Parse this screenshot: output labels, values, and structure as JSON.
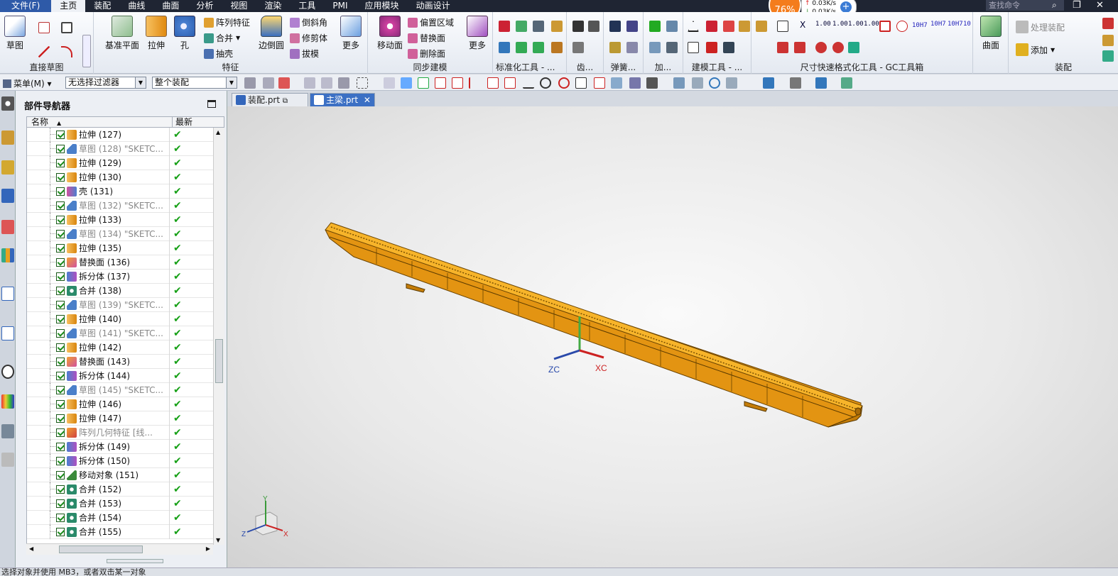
{
  "menubar": {
    "file": "文件(F)",
    "items": [
      "主页",
      "装配",
      "曲线",
      "曲面",
      "分析",
      "视图",
      "渲染",
      "工具",
      "PMI",
      "应用模块",
      "动画设计"
    ],
    "search_placeholder": "查找命令"
  },
  "perf": {
    "percent": "76%",
    "up": "0.03K/s",
    "down": "0.03K/s"
  },
  "ribbon": {
    "sketch_group": {
      "label": "直接草图",
      "sketch": "草图"
    },
    "feature_group": {
      "label": "特征",
      "datum_plane": "基准平面",
      "extrude": "拉伸",
      "hole": "孔",
      "pattern": "阵列特征",
      "unite": "合并",
      "shell": "抽壳",
      "edge_blend": "边倒圆",
      "chamfer": "倒斜角",
      "trim_body": "修剪体",
      "draft": "拔模",
      "more": "更多"
    },
    "sync_group": {
      "label": "同步建模",
      "move_face": "移动面",
      "offset_region": "偏置区域",
      "replace_face": "替换面",
      "delete_face": "删除面",
      "more": "更多"
    },
    "std_tools": {
      "label": "标准化工具 - ..."
    },
    "gear": {
      "label": "齿..."
    },
    "spring": {
      "label": "弹簧..."
    },
    "add": {
      "label": "加..."
    },
    "modeling_tools": {
      "label": "建模工具 - ..."
    },
    "dim_tools": {
      "label": "尺寸快速格式化工具 - GC工具箱",
      "t1": "1.00",
      "t2": "1.00",
      "t3": "1.00",
      "t4": "1.00",
      "x": "X",
      "h7a": "10H7",
      "h7b": "10H7",
      "h7c": "10H7",
      "h7d": "10"
    },
    "surface_group": {
      "surface": "曲面"
    },
    "assembly_group": {
      "label": "装配",
      "process": "处理装配",
      "add": "添加"
    }
  },
  "toolbar2": {
    "menu": "菜单(M)",
    "filter": "无选择过滤器",
    "scope": "整个装配"
  },
  "navigator": {
    "title": "部件导航器",
    "col_name": "名称",
    "col_latest": "最新",
    "rows": [
      {
        "label": "拉伸 (127)",
        "type": "extrude"
      },
      {
        "label": "草图 (128) \"SKETC...",
        "type": "sketch"
      },
      {
        "label": "拉伸 (129)",
        "type": "extrude"
      },
      {
        "label": "拉伸 (130)",
        "type": "extrude"
      },
      {
        "label": "壳 (131)",
        "type": "shell"
      },
      {
        "label": "草图 (132) \"SKETC...",
        "type": "sketch"
      },
      {
        "label": "拉伸 (133)",
        "type": "extrude"
      },
      {
        "label": "草图 (134) \"SKETC...",
        "type": "sketch"
      },
      {
        "label": "拉伸 (135)",
        "type": "extrude"
      },
      {
        "label": "替换面 (136)",
        "type": "replace"
      },
      {
        "label": "拆分体 (137)",
        "type": "split"
      },
      {
        "label": "合并 (138)",
        "type": "unite"
      },
      {
        "label": "草图 (139) \"SKETC...",
        "type": "sketch"
      },
      {
        "label": "拉伸 (140)",
        "type": "extrude"
      },
      {
        "label": "草图 (141) \"SKETC...",
        "type": "sketch"
      },
      {
        "label": "拉伸 (142)",
        "type": "extrude"
      },
      {
        "label": "替换面 (143)",
        "type": "replace"
      },
      {
        "label": "拆分体 (144)",
        "type": "split"
      },
      {
        "label": "草图 (145) \"SKETC...",
        "type": "sketch"
      },
      {
        "label": "拉伸 (146)",
        "type": "extrude"
      },
      {
        "label": "拉伸 (147)",
        "type": "extrude"
      },
      {
        "label": "阵列几何特征 [线...",
        "type": "pattern"
      },
      {
        "label": "拆分体 (149)",
        "type": "split"
      },
      {
        "label": "拆分体 (150)",
        "type": "split"
      },
      {
        "label": "移动对象 (151)",
        "type": "move"
      },
      {
        "label": "合并 (152)",
        "type": "unite"
      },
      {
        "label": "合并 (153)",
        "type": "unite"
      },
      {
        "label": "合并 (154)",
        "type": "unite"
      },
      {
        "label": "合并 (155)",
        "type": "unite"
      }
    ]
  },
  "tabs": [
    {
      "label": "装配.prt",
      "active": false
    },
    {
      "label": "主梁.prt",
      "active": true
    }
  ],
  "viewport": {
    "wcs": {
      "xc": "XC",
      "zc": "ZC"
    },
    "triad": {
      "x": "X",
      "y": "Y",
      "z": "Z"
    }
  },
  "colors": {
    "beam": "#f0a010",
    "beam_dark": "#c47c08",
    "extrude_icon": "#e89a1c",
    "sketch_icon": "#4a7fc9",
    "check": "#16a016"
  },
  "statusbar": {
    "text": "选择对象并使用 MB3，或者双击某一对象"
  }
}
